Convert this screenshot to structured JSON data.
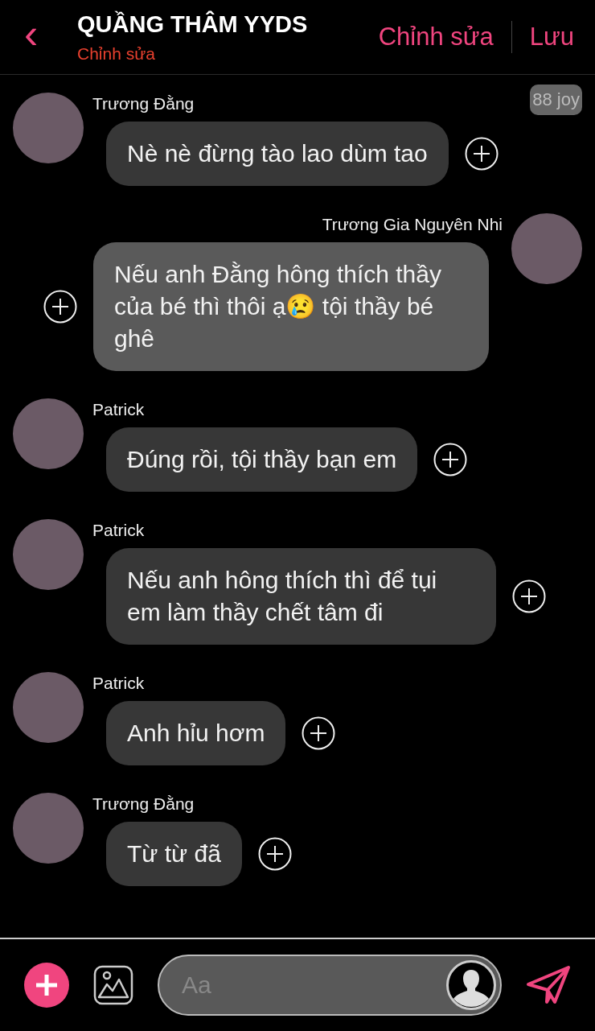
{
  "header": {
    "back": "‹",
    "title": "QUẦNG THÂM YYDS",
    "subtitle": "Chỉnh sửa",
    "actions": [
      "Chỉnh sửa",
      "Lưu"
    ]
  },
  "badge": "88 joy",
  "messages": [
    {
      "kind": "left",
      "sender": "Trương Đằng",
      "text": "Nè nè đừng tào lao dùm tao"
    },
    {
      "kind": "right",
      "sender": "Trương Gia Nguyên Nhi",
      "text": "Nếu anh Đằng hông thích thầy của bé thì thôi ạ😢 tội thầy bé ghê"
    },
    {
      "kind": "left",
      "sender": "Patrick",
      "text": "Đúng rồi, tội thầy bạn em"
    },
    {
      "kind": "left",
      "sender": "Patrick",
      "text": "Nếu anh hông thích thì để tụi em làm thầy chết tâm đi"
    },
    {
      "kind": "left",
      "sender": "Patrick",
      "text": "Anh hỉu hơm"
    },
    {
      "kind": "left",
      "sender": "Trương Đằng",
      "text": "Từ từ đã"
    }
  ],
  "composer": {
    "placeholder": "Aa"
  }
}
